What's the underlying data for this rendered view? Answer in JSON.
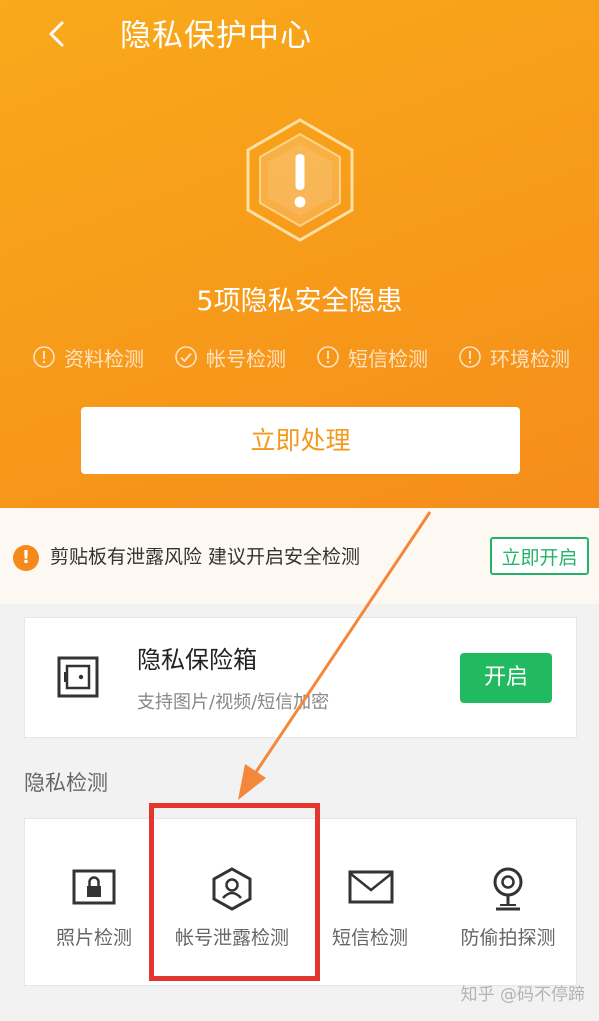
{
  "header": {
    "title": "隐私保护中心",
    "back_icon": "chevron-left-icon"
  },
  "summary": {
    "risk_text": "5项隐私安全隐患",
    "alert_icon": "hexagon-exclamation-icon"
  },
  "checks": [
    {
      "label": "资料检测",
      "icon": "exclamation-circle-icon"
    },
    {
      "label": "帐号检测",
      "icon": "check-circle-icon"
    },
    {
      "label": "短信检测",
      "icon": "exclamation-circle-icon"
    },
    {
      "label": "环境检测",
      "icon": "exclamation-circle-icon"
    }
  ],
  "primary_action": "立即处理",
  "clipboard_alert": {
    "text": "剪贴板有泄露风险 建议开启安全检测",
    "button": "立即开启"
  },
  "vault": {
    "title": "隐私保险箱",
    "subtitle": "支持图片/视频/短信加密",
    "button": "开启",
    "icon": "safe-icon"
  },
  "privacy_section": {
    "title": "隐私检测",
    "items": [
      {
        "label": "照片检测",
        "icon": "photo-lock-icon"
      },
      {
        "label": "帐号泄露检测",
        "icon": "account-shield-icon"
      },
      {
        "label": "短信检测",
        "icon": "envelope-icon"
      },
      {
        "label": "防偷拍探测",
        "icon": "camera-icon"
      }
    ]
  },
  "colors": {
    "hero": "#f79a1a",
    "accent_green": "#22ba61",
    "highlight_red": "#e2372f",
    "cta_text": "#f19a1c"
  },
  "watermark": "知乎 @码不停蹄"
}
